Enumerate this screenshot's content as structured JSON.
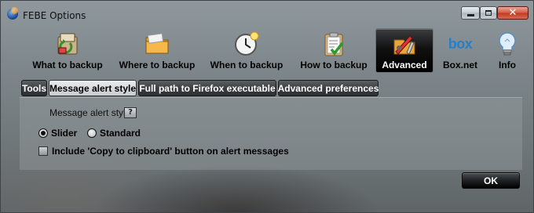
{
  "window": {
    "title": "FEBE Options",
    "controls": {
      "minimize": "minimize",
      "maximize": "maximize",
      "close": "✕"
    }
  },
  "toolbar": {
    "items": [
      {
        "label": "What to backup",
        "icon": "backup-items-icon"
      },
      {
        "label": "Where to backup",
        "icon": "folder-icon"
      },
      {
        "label": "When to backup",
        "icon": "clock-icon"
      },
      {
        "label": "How to backup",
        "icon": "clipboard-check-icon"
      },
      {
        "label": "Advanced",
        "icon": "advanced-tools-icon",
        "active": true
      },
      {
        "label": "Box.net",
        "icon": "box-logo-icon",
        "logo_text": "box"
      },
      {
        "label": "Info",
        "icon": "lightbulb-icon"
      }
    ]
  },
  "tabs": [
    {
      "label": "Tools"
    },
    {
      "label": "Message alert style",
      "selected": true
    },
    {
      "label": "Full path to Firefox executable"
    },
    {
      "label": "Advanced preferences"
    }
  ],
  "alert_style": {
    "label": "Message alert style",
    "help_symbol": "?",
    "options": [
      {
        "label": "Slider",
        "selected": true
      },
      {
        "label": "Standard",
        "selected": false
      }
    ],
    "clipboard_checkbox": {
      "label": "Include 'Copy to clipboard' button on alert messages",
      "checked": false
    }
  },
  "footer": {
    "ok_label": "OK"
  },
  "colors": {
    "active_tab_bg": "#000000",
    "close_button": "#c7432c"
  }
}
